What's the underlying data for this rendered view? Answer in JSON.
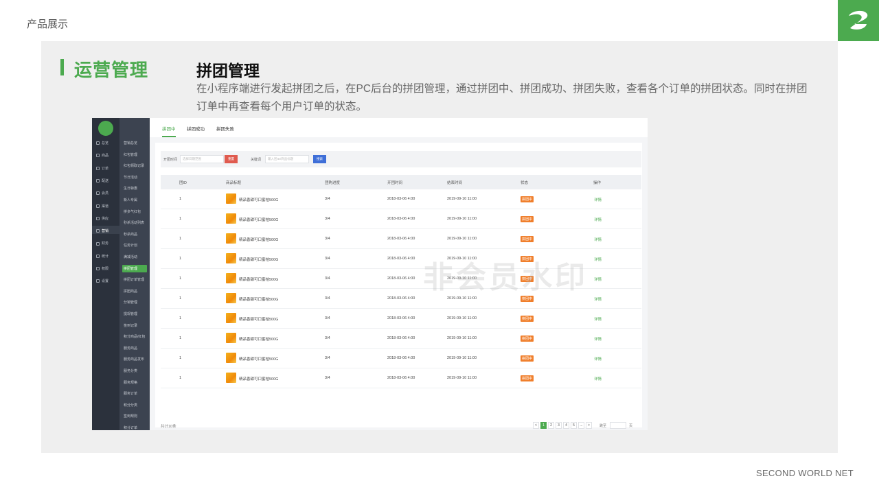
{
  "slide": {
    "top_label": "产品展示",
    "section_title": "运营管理",
    "feature_title": "拼团管理",
    "description": "在小程序端进行发起拼团之后，在PC后台的拼团管理，通过拼团中、拼团成功、拼团失败，查看各个订单的拼团状态。同时在拼团订单中再查看每个用户订单的状态。",
    "footer": "SECOND WORLD NET",
    "accent_color": "#4caa4f"
  },
  "app": {
    "primary_nav": [
      {
        "label": "总览",
        "icon": "home-icon"
      },
      {
        "label": "商品",
        "icon": "goods-icon"
      },
      {
        "label": "订单",
        "icon": "order-icon"
      },
      {
        "label": "配送",
        "icon": "delivery-icon"
      },
      {
        "label": "会员",
        "icon": "member-icon"
      },
      {
        "label": "渠道",
        "icon": "channel-icon"
      },
      {
        "label": "供应",
        "icon": "supply-icon"
      },
      {
        "label": "营销",
        "icon": "marketing-icon",
        "active": true
      },
      {
        "label": "财务",
        "icon": "finance-icon"
      },
      {
        "label": "统计",
        "icon": "stats-icon"
      },
      {
        "label": "权限",
        "icon": "permission-icon"
      },
      {
        "label": "设置",
        "icon": "settings-icon"
      }
    ],
    "secondary_nav": [
      {
        "label": "营销总览"
      },
      {
        "label": "红包管理"
      },
      {
        "label": "红包领取记录"
      },
      {
        "label": "节日活动"
      },
      {
        "label": "生日特惠"
      },
      {
        "label": "新人专属"
      },
      {
        "label": "拼多气红包"
      },
      {
        "label": "秒杀活动列表"
      },
      {
        "label": "秒杀商品"
      },
      {
        "label": "任务计划"
      },
      {
        "label": "满减活动"
      },
      {
        "label": "拼团管理",
        "active": true
      },
      {
        "label": "拼团订单管理"
      },
      {
        "label": "拼团商品"
      },
      {
        "label": "分销管理"
      },
      {
        "label": "提现管理"
      },
      {
        "label": "签到记录"
      },
      {
        "label": "积分商品/红包"
      },
      {
        "label": "服务商品"
      },
      {
        "label": "服务商品发布"
      },
      {
        "label": "服务分类"
      },
      {
        "label": "服务规格"
      },
      {
        "label": "服务订单"
      },
      {
        "label": "积分分类"
      },
      {
        "label": "签到规则"
      },
      {
        "label": "积分订单"
      }
    ],
    "tabs": [
      "拼团中",
      "拼团成功",
      "拼团失败"
    ],
    "filter": {
      "time_label": "开团时间",
      "time_placeholder": "选择日期范围",
      "reset_label": "重置",
      "keyword_label": "关键词",
      "keyword_placeholder": "输入团ID/商品标题",
      "search_label": "搜索"
    },
    "table": {
      "headers": [
        "团ID",
        "商品标题",
        "团购进度",
        "开团时间",
        "结束时间",
        "状态",
        "操作"
      ],
      "rows": [
        {
          "id": "1",
          "title": "精品香甜可口蜜桔500G",
          "progress": "3/4",
          "start": "2018-03-06 4:00",
          "end": "2019-09-10 11:00",
          "status": "拼团中",
          "action": "详情"
        },
        {
          "id": "1",
          "title": "精品香甜可口蜜桔500G",
          "progress": "3/4",
          "start": "2018-03-06 4:00",
          "end": "2019-09-10 11:00",
          "status": "拼团中",
          "action": "详情"
        },
        {
          "id": "1",
          "title": "精品香甜可口蜜桔500G",
          "progress": "3/4",
          "start": "2018-03-06 4:00",
          "end": "2019-09-10 11:00",
          "status": "拼团中",
          "action": "详情"
        },
        {
          "id": "1",
          "title": "精品香甜可口蜜桔500G",
          "progress": "3/4",
          "start": "2018-03-06 4:00",
          "end": "2019-09-10 11:00",
          "status": "拼团中",
          "action": "详情"
        },
        {
          "id": "1",
          "title": "精品香甜可口蜜桔500G",
          "progress": "3/4",
          "start": "2018-03-06 4:00",
          "end": "2019-09-10 11:00",
          "status": "拼团中",
          "action": "详情"
        },
        {
          "id": "1",
          "title": "精品香甜可口蜜桔500G",
          "progress": "3/4",
          "start": "2018-03-06 4:00",
          "end": "2019-09-10 11:00",
          "status": "拼团中",
          "action": "详情"
        },
        {
          "id": "1",
          "title": "精品香甜可口蜜桔500G",
          "progress": "3/4",
          "start": "2018-03-06 4:00",
          "end": "2019-09-10 11:00",
          "status": "拼团中",
          "action": "详情"
        },
        {
          "id": "1",
          "title": "精品香甜可口蜜桔500G",
          "progress": "3/4",
          "start": "2018-03-06 4:00",
          "end": "2019-09-10 11:00",
          "status": "拼团中",
          "action": "详情"
        },
        {
          "id": "1",
          "title": "精品香甜可口蜜桔500G",
          "progress": "3/4",
          "start": "2018-03-06 4:00",
          "end": "2019-09-10 11:00",
          "status": "拼团中",
          "action": "详情"
        },
        {
          "id": "1",
          "title": "精品香甜可口蜜桔500G",
          "progress": "3/4",
          "start": "2018-03-06 4:00",
          "end": "2019-09-10 11:00",
          "status": "拼团中",
          "action": "详情"
        }
      ]
    },
    "total_text": "共计10条",
    "pagination": {
      "prev": "<",
      "pages": [
        "1",
        "2",
        "3",
        "4",
        "5",
        "..."
      ],
      "next": ">",
      "goto_label": "跳至",
      "page_unit": "页",
      "current_page": "1"
    },
    "watermark": "非会员水印",
    "status_color": "#f07f2c"
  }
}
